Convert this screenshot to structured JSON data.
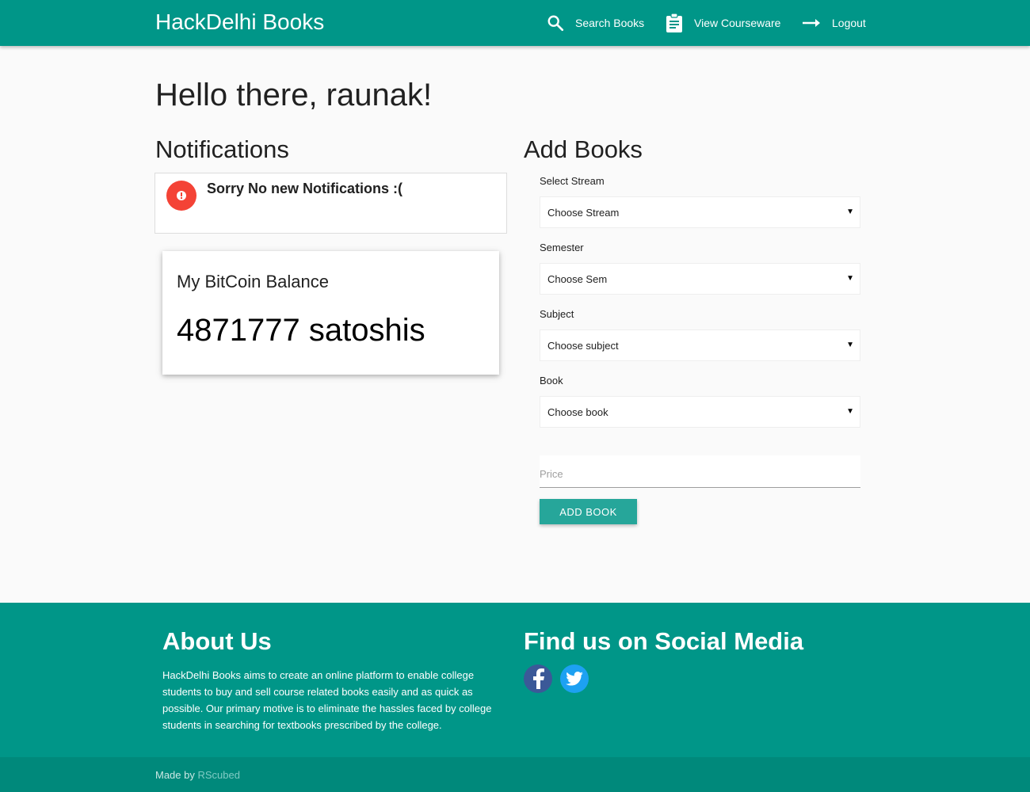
{
  "nav": {
    "brand": "HackDelhi Books",
    "links": [
      {
        "label": "Search Books",
        "icon": "search-icon"
      },
      {
        "label": "View Courseware",
        "icon": "clipboard-icon"
      },
      {
        "label": "Logout",
        "icon": "arrow-right-icon"
      }
    ]
  },
  "greeting": "Hello there, raunak!",
  "notifications": {
    "title": "Notifications",
    "message": "Sorry No new Notifications :(",
    "icon": "alert-icon"
  },
  "balance": {
    "title": "My BitCoin Balance",
    "value": "4871777 satoshis"
  },
  "add_books": {
    "title": "Add Books",
    "fields": [
      {
        "label": "Select Stream",
        "value": "Choose Stream"
      },
      {
        "label": "Semester",
        "value": "Choose Sem"
      },
      {
        "label": "Subject",
        "value": "Choose subject"
      },
      {
        "label": "Book",
        "value": "Choose book"
      }
    ],
    "price_placeholder": "Price",
    "button": "ADD BOOK"
  },
  "footer": {
    "about_title": "About Us",
    "about_text": "HackDelhi Books aims to create an online platform to enable college students to buy and sell course related books easily and as quick as possible. Our primary motive is to eliminate the hassles faced by college students in searching for textbooks prescribed by the college.",
    "social_title": "Find us on Social Media",
    "social": [
      {
        "name": "facebook-icon"
      },
      {
        "name": "twitter-icon"
      }
    ],
    "made_by_prefix": "Made by",
    "made_by_link": "RScubed"
  },
  "colors": {
    "primary": "#009688",
    "primary_dark": "#00897b",
    "button": "#26a69a",
    "alert": "#f44336"
  }
}
